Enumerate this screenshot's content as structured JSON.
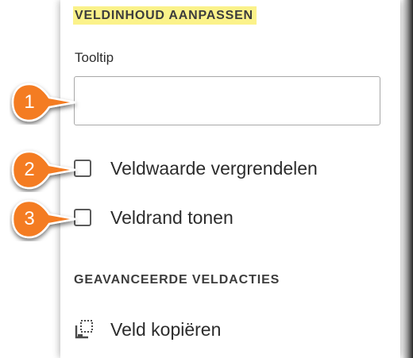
{
  "panel": {
    "section_title": "VELDINHOUD AANPASSEN",
    "tooltip": {
      "label": "Tooltip",
      "value": "",
      "placeholder": ""
    },
    "checkboxes": [
      {
        "label": "Veldwaarde vergrendelen",
        "checked": false
      },
      {
        "label": "Veldrand tonen",
        "checked": false
      }
    ],
    "advanced_title": "GEAVANCEERDE VELDACTIES",
    "actions": [
      {
        "label": "Veld kopiëren",
        "icon": "copy-field-icon"
      }
    ]
  },
  "callouts": [
    "1",
    "2",
    "3"
  ],
  "colors": {
    "callout_orange": "#f47b20",
    "highlight_yellow": "#fbf28a",
    "text": "#2c2c2c"
  }
}
